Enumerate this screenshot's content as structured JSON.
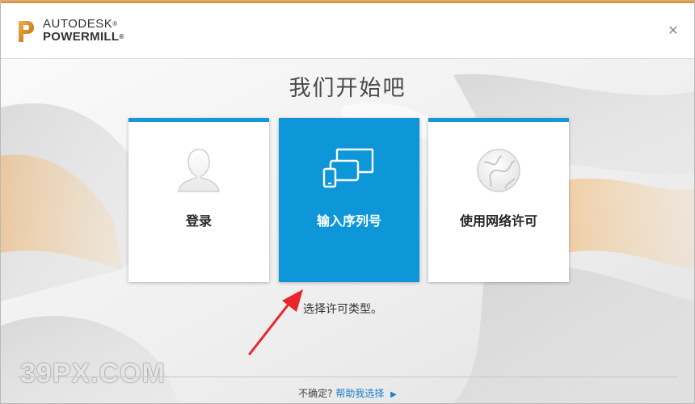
{
  "header": {
    "brand_line1": "AUTODESK",
    "brand_line2": "POWERMILL",
    "brand_mark": "®",
    "logo_icon": "autodesk-p-logo",
    "close_icon": "close-x",
    "close_glyph": "✕"
  },
  "main": {
    "title": "我们开始吧",
    "cards": [
      {
        "label": "登录",
        "icon": "user-silhouette",
        "selected": false
      },
      {
        "label": "输入序列号",
        "icon": "devices",
        "selected": true
      },
      {
        "label": "使用网络许可",
        "icon": "network-globe",
        "selected": false
      }
    ],
    "hint": "选择许可类型。"
  },
  "footer": {
    "question": "不确定?",
    "link": "帮助我选择",
    "link_icon": "triangle-right",
    "link_glyph": "▶"
  },
  "watermark": "39PX.COM",
  "colors": {
    "accent_orange": "#e8952e",
    "card_blue": "#1598d9",
    "selected_blue": "#0d96d8",
    "link_blue": "#1a7fc8",
    "arrow_red": "#e8262b"
  }
}
